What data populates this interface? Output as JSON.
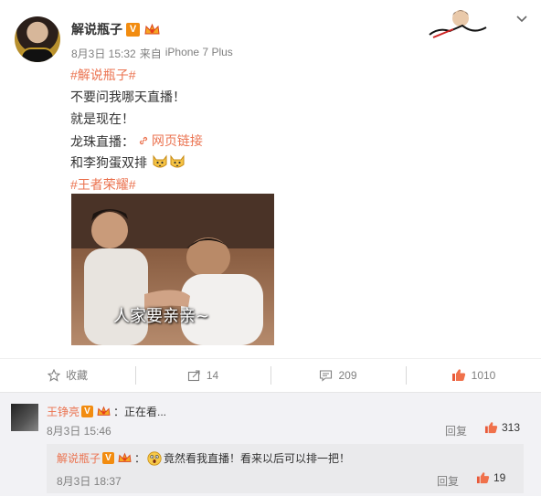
{
  "post": {
    "username": "解说瓶子",
    "verified_badge": "V",
    "meta": {
      "date": "8月3日 15:32",
      "source_prefix": "来自",
      "source": "iPhone 7 Plus"
    },
    "lines": {
      "hashtag1": "#解说瓶子#",
      "line1": "不要问我哪天直播！",
      "line2": "就是现在！",
      "live_label": "龙珠直播：",
      "link_label": "网页链接",
      "line4": "和李狗蛋双排",
      "hashtag2": "#王者荣耀#"
    },
    "photo_caption": "人家要亲亲~"
  },
  "actions": {
    "favorite_label": "收藏",
    "repost_count": "14",
    "comment_count": "209",
    "like_count": "1010"
  },
  "comment": {
    "username": "王铮亮",
    "verified_badge": "V",
    "text": "：正在看...",
    "time": "8月3日 15:46",
    "reply_label": "回复",
    "like_count": "313"
  },
  "sub_comment": {
    "username": "解说瓶子",
    "verified_badge": "V",
    "text": "竟然看我直播！看来以后可以排一把！",
    "time": "8月3日 18:37",
    "reply_label": "回复",
    "like_count": "19"
  },
  "colors": {
    "accent": "#eb7350",
    "badge_orange": "#f28c10",
    "meta_gray": "#808080",
    "comment_bg": "#f2f2f5"
  },
  "icons": [
    "star-icon",
    "repost-icon",
    "comment-icon",
    "thumbs-up-icon",
    "link-icon",
    "chevron-down-icon",
    "cat-emoji-icon",
    "shocked-emoji-icon",
    "vip-crown-icon"
  ]
}
